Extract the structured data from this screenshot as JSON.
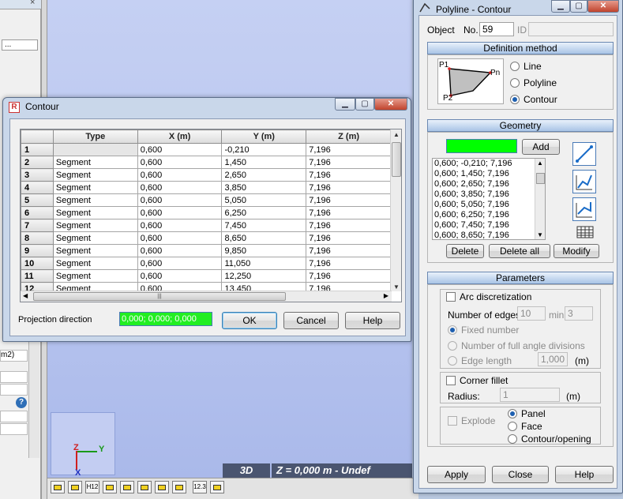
{
  "contour_dialog": {
    "title": "Contour",
    "title_icon": "R",
    "columns": [
      "",
      "Type",
      "X (m)",
      "Y (m)",
      "Z (m)"
    ],
    "rows": [
      {
        "n": "1",
        "type": "",
        "x": "0,600",
        "y": "-0,210",
        "z": "7,196"
      },
      {
        "n": "2",
        "type": "Segment",
        "x": "0,600",
        "y": "1,450",
        "z": "7,196"
      },
      {
        "n": "3",
        "type": "Segment",
        "x": "0,600",
        "y": "2,650",
        "z": "7,196"
      },
      {
        "n": "4",
        "type": "Segment",
        "x": "0,600",
        "y": "3,850",
        "z": "7,196"
      },
      {
        "n": "5",
        "type": "Segment",
        "x": "0,600",
        "y": "5,050",
        "z": "7,196"
      },
      {
        "n": "6",
        "type": "Segment",
        "x": "0,600",
        "y": "6,250",
        "z": "7,196"
      },
      {
        "n": "7",
        "type": "Segment",
        "x": "0,600",
        "y": "7,450",
        "z": "7,196"
      },
      {
        "n": "8",
        "type": "Segment",
        "x": "0,600",
        "y": "8,650",
        "z": "7,196"
      },
      {
        "n": "9",
        "type": "Segment",
        "x": "0,600",
        "y": "9,850",
        "z": "7,196"
      },
      {
        "n": "10",
        "type": "Segment",
        "x": "0,600",
        "y": "11,050",
        "z": "7,196"
      },
      {
        "n": "11",
        "type": "Segment",
        "x": "0,600",
        "y": "12,250",
        "z": "7,196"
      },
      {
        "n": "12",
        "type": "Segment",
        "x": "0,600",
        "y": "13,450",
        "z": "7,196"
      }
    ],
    "projection_label": "Projection direction",
    "projection_value": "0,000; 0,000; 0,000",
    "ok": "OK",
    "cancel": "Cancel",
    "help": "Help"
  },
  "poly_dialog": {
    "title": "Polyline - Contour",
    "object_label": "Object",
    "no_label": "No.",
    "no_value": "59",
    "id_label": "ID",
    "id_value": "",
    "definition_header": "Definition method",
    "diagram": {
      "p1": "P1",
      "pn": "Pn",
      "p2": "P2"
    },
    "methods": [
      "Line",
      "Polyline",
      "Contour"
    ],
    "selected_method": "Contour",
    "geometry_header": "Geometry",
    "add": "Add",
    "points": [
      "0,600; -0,210; 7,196",
      "0,600; 1,450; 7,196",
      "0,600; 2,650; 7,196",
      "0,600; 3,850; 7,196",
      "0,600; 5,050; 7,196",
      "0,600; 6,250; 7,196",
      "0,600; 7,450; 7,196",
      "0,600; 8,650; 7,196"
    ],
    "delete": "Delete",
    "delete_all": "Delete all",
    "modify": "Modify",
    "parameters_header": "Parameters",
    "arc_discretization": "Arc discretization",
    "number_of_edges": "Number of edges:",
    "edges_value": "10",
    "min_label": "min",
    "min_value": "3",
    "fixed_number": "Fixed number",
    "full_angle": "Number of full angle divisions",
    "edge_length": "Edge length",
    "edge_length_value": "1,000",
    "edge_length_unit": "(m)",
    "corner_fillet": "Corner fillet",
    "radius_label": "Radius:",
    "radius_value": "1",
    "radius_unit": "(m)",
    "explode": "Explode",
    "explode_options": [
      "Panel",
      "Face",
      "Contour/opening"
    ],
    "selected_explode": "Panel",
    "apply": "Apply",
    "close": "Close",
    "help": "Help"
  },
  "workspace": {
    "view_mode": "3D",
    "coord_text": "Z = 0,000 m - Undef",
    "axes": {
      "x": "X",
      "y": "Y",
      "z": "Z"
    },
    "left_field": "...",
    "left_unit": "m2)",
    "help_glyph": "?",
    "close_glyph": "×",
    "toolbar_texts": [
      "H12",
      "12.3"
    ]
  },
  "colors": {
    "projection_field": "#22ee22",
    "geometry_field": "#00ff00",
    "accent": "#1d5fb0"
  }
}
